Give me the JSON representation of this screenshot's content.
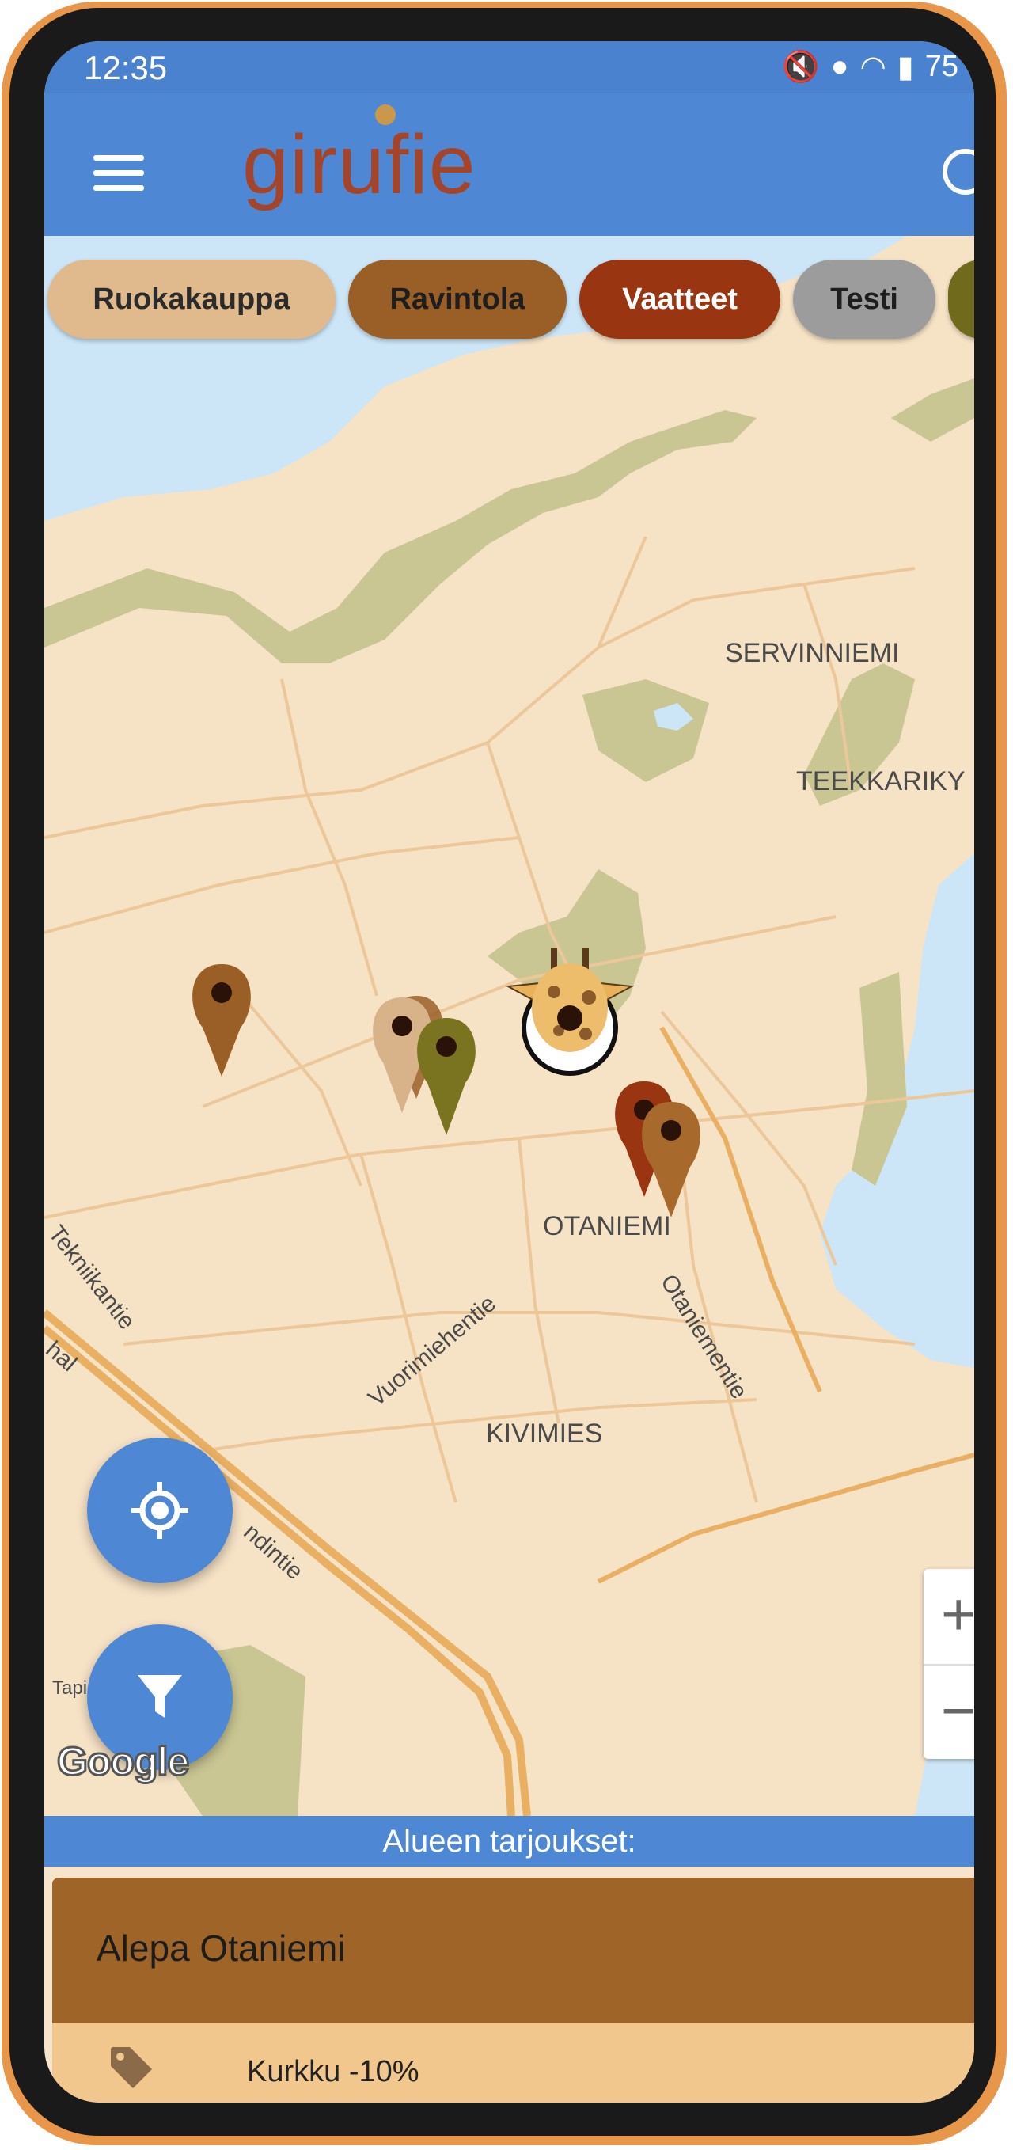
{
  "status_bar": {
    "time": "12:35",
    "battery": "75"
  },
  "app_bar": {
    "logo_text": "girufie",
    "menu_icon": "hamburger-menu-icon",
    "right_icon": "search-icon"
  },
  "categories": [
    {
      "label": "Ruokakauppa",
      "color": "#e0b98c"
    },
    {
      "label": "Ravintola",
      "color": "#9a5f27"
    },
    {
      "label": "Vaatteet",
      "color": "#9a3512"
    },
    {
      "label": "Testi",
      "color": "#9c9c9c"
    },
    {
      "label": "",
      "color": "#6f6a1c"
    }
  ],
  "map": {
    "places": {
      "servinniemi": "SERVINNIEMI",
      "teekkarikyla": "TEEKKARIKY",
      "otaniemi": "OTANIEMI",
      "kivimies": "KIVIMIES",
      "tapiola": "Tapiola"
    },
    "roads": {
      "vuorimiehentie": "Vuorimiehentie",
      "otaniementie": "Otaniementie",
      "tekniikantie": "Tekniikantie",
      "rantatie_fragment": "ndintie",
      "hal_fragment": "hal"
    },
    "attribution": "Google",
    "user_marker_icon": "giraffe-avatar-icon",
    "zoom_in": "+",
    "zoom_out": "−"
  },
  "fabs": {
    "locate_icon": "gps-locate-icon",
    "filter_icon": "filter-funnel-icon"
  },
  "offers": {
    "header": "Alueen tarjoukset:",
    "store_name": "Alepa Otaniemi",
    "items": [
      {
        "label": "Kurkku -10%",
        "icon": "price-tag-icon"
      }
    ]
  }
}
